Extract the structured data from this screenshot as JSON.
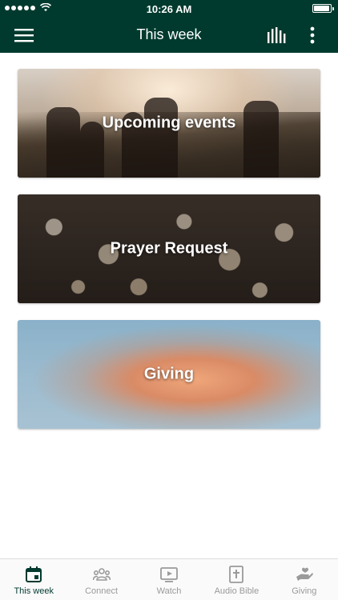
{
  "status_bar": {
    "time": "10:26 AM"
  },
  "app_bar": {
    "title": "This week",
    "menu_icon": "hamburger-menu-icon",
    "stats_icon": "bar-chart-icon",
    "more_icon": "more-vertical-icon"
  },
  "cards": [
    {
      "label": "Upcoming events"
    },
    {
      "label": "Prayer Request"
    },
    {
      "label": "Giving"
    }
  ],
  "bottom_nav": {
    "tabs": [
      {
        "label": "This week",
        "icon": "calendar-icon",
        "active": true
      },
      {
        "label": "Connect",
        "icon": "people-icon",
        "active": false
      },
      {
        "label": "Watch",
        "icon": "play-video-icon",
        "active": false
      },
      {
        "label": "Audio Bible",
        "icon": "bible-icon",
        "active": false
      },
      {
        "label": "Giving",
        "icon": "giving-hand-icon",
        "active": false
      }
    ]
  },
  "colors": {
    "primary": "#003a2e",
    "inactive": "#9a9a9a"
  }
}
